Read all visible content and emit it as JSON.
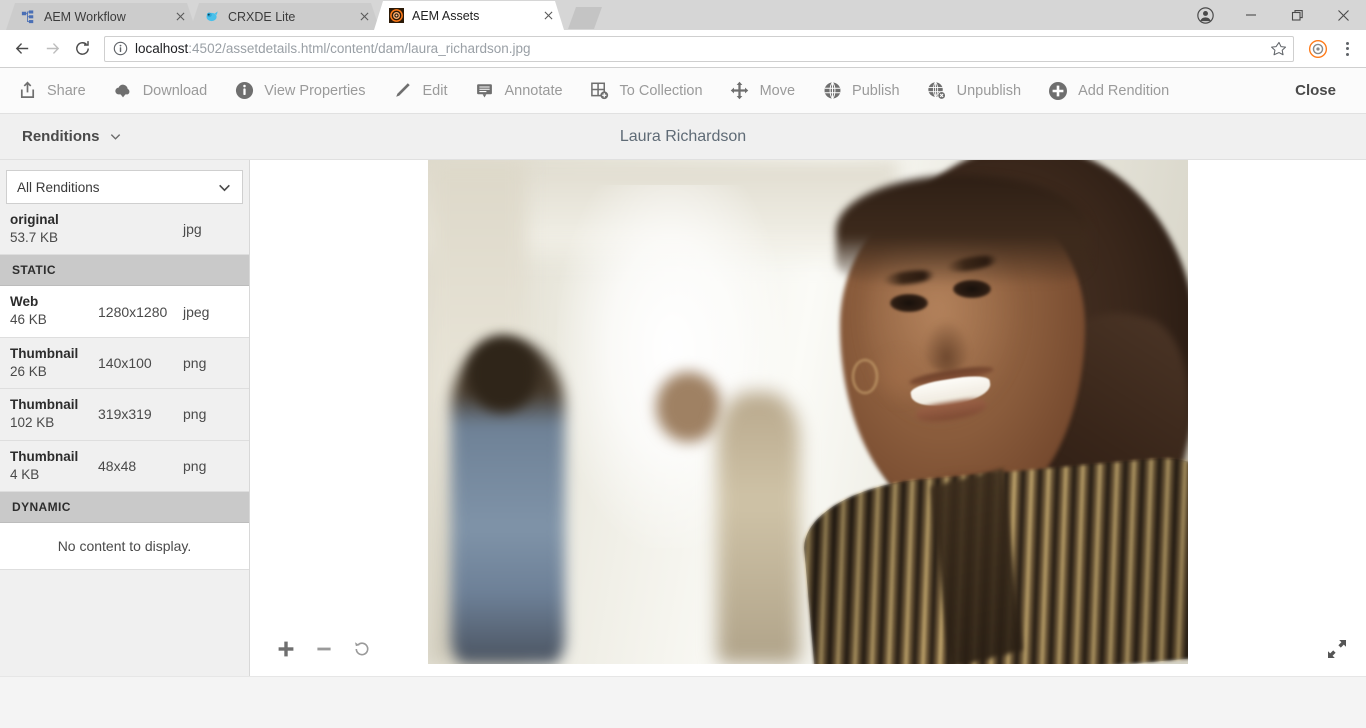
{
  "browser": {
    "tabs": [
      {
        "title": "AEM Workflow",
        "favicon": "workflow-icon",
        "active": false
      },
      {
        "title": "CRXDE Lite",
        "favicon": "crxde-icon",
        "active": false
      },
      {
        "title": "AEM Assets",
        "favicon": "aem-assets-icon",
        "active": true
      }
    ],
    "new_tab_label": "",
    "window_controls": {
      "profile": "profile-icon",
      "minimize": "—",
      "maximize": "❐",
      "close": "✕"
    },
    "nav": {
      "back": "←",
      "forward": "→",
      "reload": "⟳"
    },
    "omnibox": {
      "host": "localhost",
      "rest": ":4502/assetdetails.html/content/dam/laura_richardson.jpg",
      "full_url": "localhost:4502/assetdetails.html/content/dam/laura_richardson.jpg",
      "info_icon": "page-info-icon",
      "star_icon": "bookmark-star-icon"
    },
    "extension_icon": "extension-icon",
    "menu_icon": "three-dot-menu-icon"
  },
  "toolbar": {
    "items": [
      {
        "label": "Share",
        "icon": "share-icon"
      },
      {
        "label": "Download",
        "icon": "download-cloud-icon"
      },
      {
        "label": "View Properties",
        "icon": "info-circle-icon"
      },
      {
        "label": "Edit",
        "icon": "pencil-icon"
      },
      {
        "label": "Annotate",
        "icon": "annotate-icon"
      },
      {
        "label": "To Collection",
        "icon": "collection-add-icon"
      },
      {
        "label": "Move",
        "icon": "move-arrows-icon"
      },
      {
        "label": "Publish",
        "icon": "globe-icon"
      },
      {
        "label": "Unpublish",
        "icon": "globe-remove-icon"
      },
      {
        "label": "Add Rendition",
        "icon": "plus-circle-icon"
      }
    ],
    "close_label": "Close"
  },
  "header": {
    "renditions_label": "Renditions",
    "renditions_chevron": "chevron-down-icon",
    "asset_title": "Laura Richardson"
  },
  "sidebar": {
    "filter": {
      "selected": "All Renditions",
      "chevron": "chevron-down-icon"
    },
    "rows": [
      {
        "type": "rendition",
        "name": "original",
        "size": "53.7 KB",
        "dimensions": "",
        "format": "jpg",
        "selected": false
      },
      {
        "type": "section",
        "name": "STATIC"
      },
      {
        "type": "rendition",
        "name": "Web",
        "size": "46 KB",
        "dimensions": "1280x1280",
        "format": "jpeg",
        "selected": true
      },
      {
        "type": "rendition",
        "name": "Thumbnail",
        "size": "26 KB",
        "dimensions": "140x100",
        "format": "png",
        "selected": false
      },
      {
        "type": "rendition",
        "name": "Thumbnail",
        "size": "102 KB",
        "dimensions": "319x319",
        "format": "png",
        "selected": false
      },
      {
        "type": "rendition",
        "name": "Thumbnail",
        "size": "4 KB",
        "dimensions": "48x48",
        "format": "png",
        "selected": false
      },
      {
        "type": "section",
        "name": "DYNAMIC"
      },
      {
        "type": "empty",
        "name": "No content to display."
      }
    ]
  },
  "viewer": {
    "zoom_in": "plus-icon",
    "zoom_out": "minus-icon",
    "reset": "reset-rotate-icon",
    "fullscreen": "fullscreen-expand-icon",
    "image_alt": "Laura Richardson portrait"
  },
  "colors": {
    "accent": "#ff6600",
    "toolbar_text": "#9a9a9a",
    "section_header_bg": "#c9c9c9",
    "sidebar_bg": "#f0f0f0"
  }
}
